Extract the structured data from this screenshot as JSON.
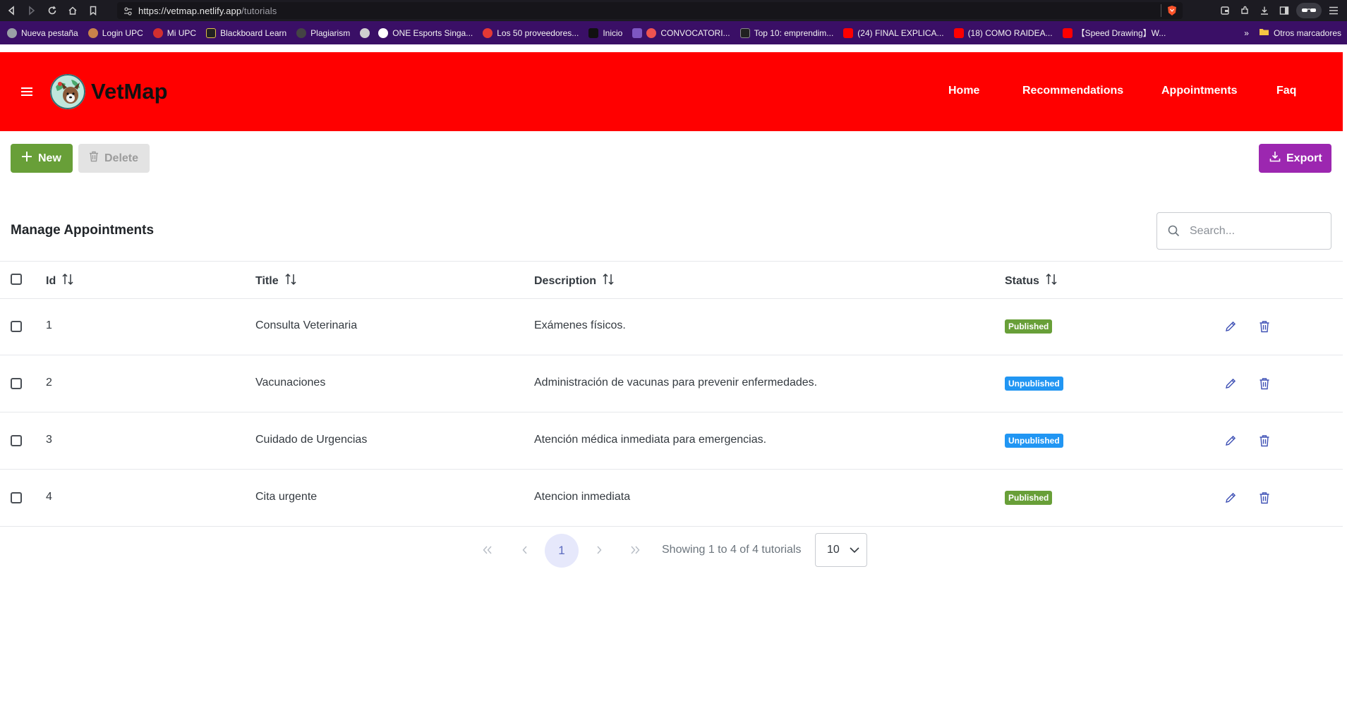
{
  "browser": {
    "url_host": "https://vetmap.netlify.app",
    "url_path": "/tutorials",
    "bookmarks": [
      {
        "label": "Nueva pestaña",
        "color": "#9aa0a6"
      },
      {
        "label": "Login UPC",
        "color": "#c9824a"
      },
      {
        "label": "Mi UPC",
        "color": "#d32f2f"
      },
      {
        "label": "Blackboard Learn",
        "color": "#222222"
      },
      {
        "label": "Plagiarism",
        "color": "#444444"
      },
      {
        "label": "",
        "color": "#cfcfcf"
      },
      {
        "label": "ONE Esports Singa...",
        "color": "#ffffff"
      },
      {
        "label": "Los 50 proveedores...",
        "color": "#e53935"
      },
      {
        "label": "Inicio",
        "color": "#111111"
      },
      {
        "label": "",
        "color": "#7e57c2"
      },
      {
        "label": "CONVOCATORI...",
        "color": "#ef5350"
      },
      {
        "label": "Top 10: emprendim...",
        "color": "#212121"
      },
      {
        "label": "(24) FINAL EXPLICA...",
        "color": "#ff0000"
      },
      {
        "label": "(18) COMO RAIDEA...",
        "color": "#ff0000"
      },
      {
        "label": "【Speed Drawing】W...",
        "color": "#ff0000"
      }
    ],
    "more_label": "»",
    "other_bookmarks": "Otros marcadores"
  },
  "header": {
    "brand": "VetMap",
    "menu": [
      "Home",
      "Recommendations",
      "Appointments",
      "Faq"
    ],
    "bg_color": "#ff0000"
  },
  "toolbar": {
    "new_label": "New",
    "delete_label": "Delete",
    "export_label": "Export"
  },
  "card": {
    "title": "Manage Appointments",
    "search_placeholder": "Search..."
  },
  "table": {
    "columns": [
      "Id",
      "Title",
      "Description",
      "Status"
    ],
    "rows": [
      {
        "id": "1",
        "title": "Consulta Veterinaria",
        "description": "Exámenes físicos.",
        "status": "Published"
      },
      {
        "id": "2",
        "title": "Vacunaciones",
        "description": "Administración de vacunas para prevenir enfermedades.",
        "status": "Unpublished"
      },
      {
        "id": "3",
        "title": "Cuidado de Urgencias",
        "description": "Atención médica inmediata para emergencias.",
        "status": "Unpublished"
      },
      {
        "id": "4",
        "title": "Cita urgente",
        "description": "Atencion inmediata",
        "status": "Published"
      }
    ],
    "status_colors": {
      "Published": "#689f38",
      "Unpublished": "#2196f3"
    }
  },
  "paginator": {
    "current_page": "1",
    "info": "Showing 1 to 4 of 4 tutorials",
    "rows_per_page": "10"
  }
}
